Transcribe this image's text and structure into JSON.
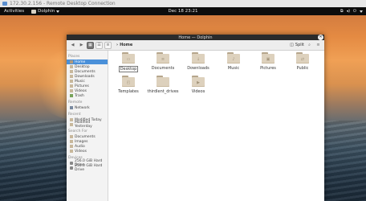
{
  "rdp_title": "172.30.2.156 - Remote Desktop Connection",
  "panel": {
    "activities": "Activities",
    "app_name": "Dolphin",
    "clock": "Dec 18 23:21"
  },
  "window": {
    "title": "Home — Dolphin"
  },
  "toolbar": {
    "breadcrumb": "Home",
    "split": "Split"
  },
  "sidebar": {
    "places_header": "Places",
    "places": [
      "Home",
      "Desktop",
      "Documents",
      "Downloads",
      "Music",
      "Pictures",
      "Videos",
      "Trash"
    ],
    "remote_header": "Remote",
    "remote": [
      "Network"
    ],
    "recent_header": "Recent",
    "recent": [
      "Modified Today",
      "Modified Yesterday"
    ],
    "search_header": "Search For",
    "search": [
      "Documents",
      "Images",
      "Audio",
      "Videos"
    ],
    "devices_header": "Devices",
    "devices": [
      "256.0 GiB Hard Drive",
      "256.0 GiB Hard Drive"
    ]
  },
  "files": [
    "Desktop",
    "Documents",
    "Downloads",
    "Music",
    "Pictures",
    "Public",
    "Templates",
    "thirdlent_drives",
    "Videos"
  ]
}
